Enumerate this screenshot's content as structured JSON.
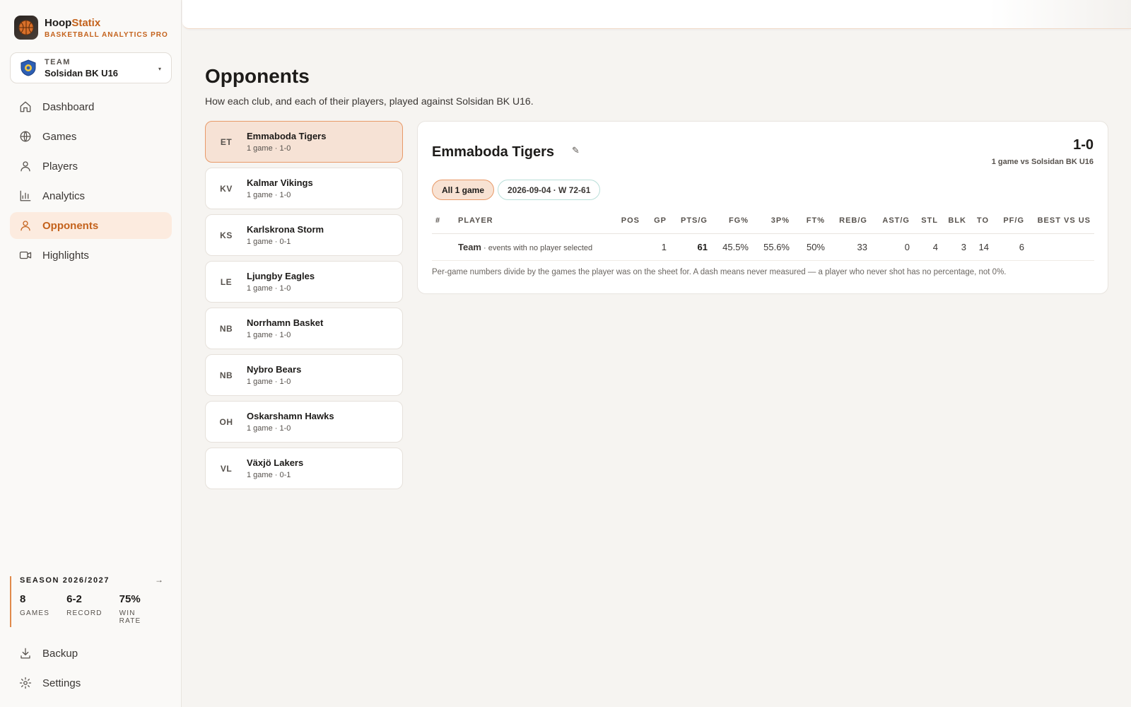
{
  "brand": {
    "name_a": "Hoop",
    "name_b": "Statix",
    "subtitle": "BASKETBALL ANALYTICS PRO"
  },
  "team": {
    "label": "TEAM",
    "name": "Solsidan BK U16",
    "caret": "▾"
  },
  "nav": [
    {
      "label": "Dashboard",
      "icon": "home-icon"
    },
    {
      "label": "Games",
      "icon": "globe-icon"
    },
    {
      "label": "Players",
      "icon": "user-icon"
    },
    {
      "label": "Analytics",
      "icon": "bar-chart-icon"
    },
    {
      "label": "Opponents",
      "icon": "user-icon",
      "active": true
    },
    {
      "label": "Highlights",
      "icon": "video-icon"
    }
  ],
  "season": {
    "title": "SEASON 2026/2027",
    "arrow": "→",
    "stats": [
      {
        "value": "8",
        "label": "GAMES"
      },
      {
        "value": "6-2",
        "label": "RECORD"
      },
      {
        "value": "75%",
        "label": "WIN RATE"
      }
    ]
  },
  "nav_bottom": [
    {
      "label": "Backup",
      "icon": "download-icon"
    },
    {
      "label": "Settings",
      "icon": "gear-icon"
    }
  ],
  "page": {
    "title": "Opponents",
    "subtitle": "How each club, and each of their players, played against Solsidan BK U16."
  },
  "opponents": [
    {
      "initials": "ET",
      "name": "Emmaboda Tigers",
      "meta": "1 game · 1-0",
      "active": true
    },
    {
      "initials": "KV",
      "name": "Kalmar Vikings",
      "meta": "1 game · 1-0"
    },
    {
      "initials": "KS",
      "name": "Karlskrona Storm",
      "meta": "1 game · 0-1"
    },
    {
      "initials": "LE",
      "name": "Ljungby Eagles",
      "meta": "1 game · 1-0"
    },
    {
      "initials": "NB",
      "name": "Norrhamn Basket",
      "meta": "1 game · 1-0"
    },
    {
      "initials": "NB",
      "name": "Nybro Bears",
      "meta": "1 game · 1-0"
    },
    {
      "initials": "OH",
      "name": "Oskarshamn Hawks",
      "meta": "1 game · 1-0"
    },
    {
      "initials": "VL",
      "name": "Växjö Lakers",
      "meta": "1 game · 0-1"
    }
  ],
  "detail": {
    "title": "Emmaboda Tigers",
    "edit_icon": "✎",
    "record": "1-0",
    "record_sub": "1 game vs Solsidan BK U16",
    "chips": {
      "all": "All 1 game",
      "game": "2026-09-04 · W 72-61"
    },
    "columns": [
      "#",
      "PLAYER",
      "POS",
      "GP",
      "PTS/G",
      "FG%",
      "3P%",
      "FT%",
      "REB/G",
      "AST/G",
      "STL",
      "BLK",
      "TO",
      "PF/G",
      "BEST VS US"
    ],
    "rows": [
      {
        "num": "",
        "player": "Team",
        "player_note": " · events with no player selected",
        "pos": "",
        "gp": "1",
        "pts": "61",
        "fg": "45.5%",
        "tp": "55.6%",
        "ft": "50%",
        "reb": "33",
        "ast": "0",
        "stl": "4",
        "blk": "3",
        "to": "14",
        "pf": "6",
        "best": ""
      }
    ],
    "footnote": "Per-game numbers divide by the games the player was on the sheet for. A dash means never measured — a player who never shot has no percentage, not 0%."
  },
  "colors": {
    "accent": "#c4621c",
    "active_bg": "#fcebdf",
    "card_active": "#f6e2d5",
    "chip_border_teal": "#b9dfd9"
  }
}
